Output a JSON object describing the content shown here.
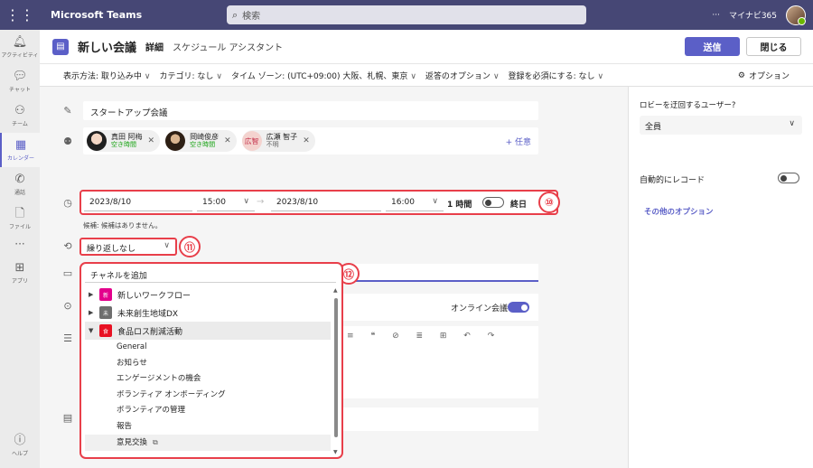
{
  "titlebar": {
    "app_name": "Microsoft Teams",
    "search_placeholder": "検索",
    "more": "···",
    "org": "マイナビ365"
  },
  "rail": {
    "items": [
      {
        "label": "アクティビティ",
        "icon": "bell-icon"
      },
      {
        "label": "チャット",
        "icon": "chat-icon"
      },
      {
        "label": "チーム",
        "icon": "teams-icon"
      },
      {
        "label": "カレンダー",
        "icon": "calendar-icon",
        "active": true
      },
      {
        "label": "通話",
        "icon": "phone-icon"
      },
      {
        "label": "ファイル",
        "icon": "file-icon"
      }
    ],
    "more": "···",
    "apps": "アプリ",
    "help": "ヘルプ"
  },
  "header": {
    "title": "新しい会議",
    "tab_details": "詳細",
    "tab_scheduling": "スケジュール アシスタント",
    "send": "送信",
    "close": "閉じる"
  },
  "options_bar": {
    "show_as": "表示方法: 取り込み中",
    "category": "カテゴリ: なし",
    "timezone": "タイム ゾーン: (UTC+09:00) 大阪、札幌、東京",
    "response": "返答のオプション",
    "registration": "登録を必須にする: なし",
    "options": "オプション"
  },
  "form": {
    "title": "スタートアップ会議",
    "attendees": [
      {
        "name": "真田 阿梅",
        "status": "空き時間",
        "color": "#2b2b2b"
      },
      {
        "name": "岡崎俊彦",
        "status": "空き時間",
        "color": "#3a2a1a"
      },
      {
        "name": "広瀬 智子",
        "status": "不明",
        "initials": "広智",
        "color": "#f4d3cf"
      }
    ],
    "optional": "+ 任意",
    "start_date": "2023/8/10",
    "start_time": "15:00",
    "end_date": "2023/8/10",
    "end_time": "16:00",
    "duration": "1 時間",
    "all_day": "終日",
    "suggestion": "候補: 候補はありません。",
    "repeat": "繰り返しなし",
    "channel_placeholder": "チャネルを追加",
    "online_meeting": "オンライン会議"
  },
  "badges": {
    "b10": "⑩",
    "b11": "⑪",
    "b12": "⑫"
  },
  "channel_dropdown": {
    "teams": [
      {
        "name": "新しいワークフロー",
        "initial": "新",
        "color": "#e3008c",
        "expanded": false
      },
      {
        "name": "未来創生地域DX",
        "initial": "未",
        "color": "#6e6e6e",
        "expanded": false
      },
      {
        "name": "食品ロス削減活動",
        "initial": "食",
        "color": "#e81123",
        "expanded": true
      }
    ],
    "channels": [
      "General",
      "お知らせ",
      "エンゲージメントの機会",
      "ボランティア オンボーディング",
      "ボランティアの管理",
      "報告",
      "意見交換"
    ]
  },
  "right_panel": {
    "bypass_label": "ロビーを迂回するユーザー?",
    "bypass_value": "全員",
    "auto_record": "自動的にレコード",
    "more_options": "その他のオプション"
  }
}
